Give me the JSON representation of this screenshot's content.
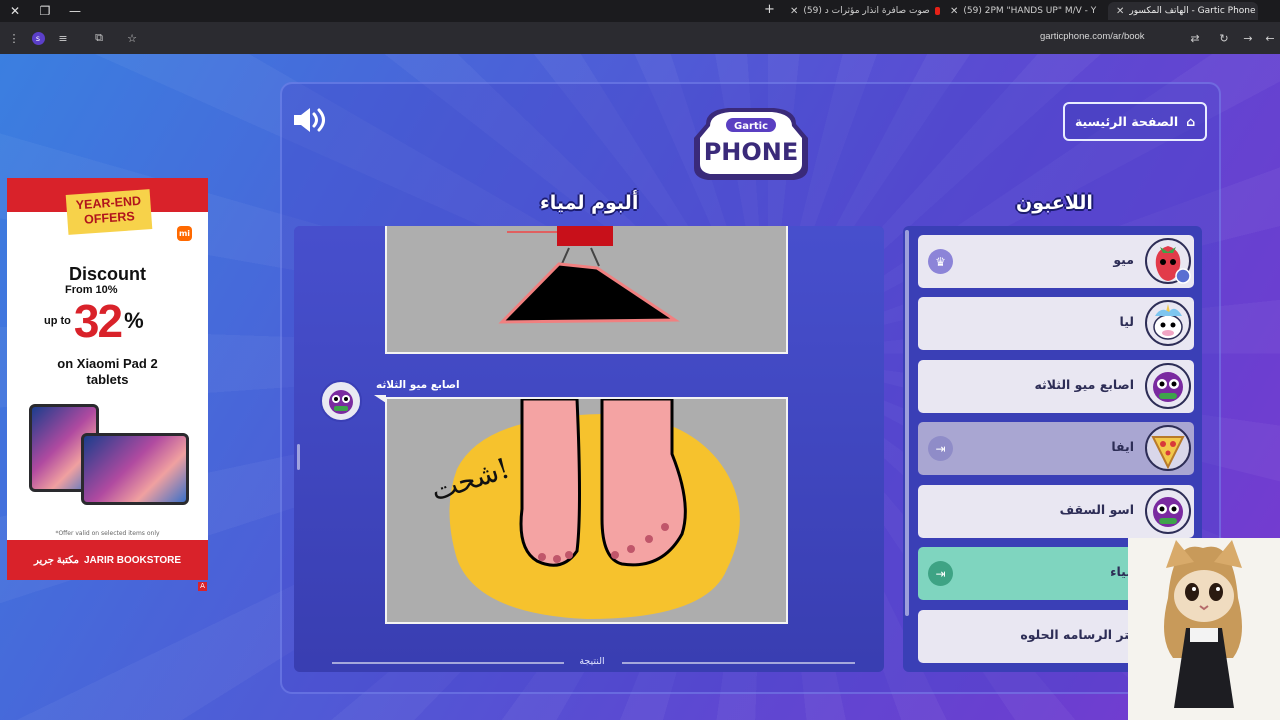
{
  "browser": {
    "tabs": [
      {
        "title": "الهاتف المكسور - Gartic Phone",
        "icon": "gartic-icon"
      },
      {
        "title": "(59) 2PM \"HANDS UP\" M/V - Y",
        "icon": "youtube-icon"
      },
      {
        "title": "(59) صوت صافرة انذار مؤثرات د",
        "icon": "youtube-icon"
      }
    ],
    "url": "garticphone.com/ar/book"
  },
  "ad": {
    "offer": "YEAR-END OFFERS",
    "brand_badge": "mi",
    "headline": "Discount",
    "from": "From 10%",
    "upto": "up to",
    "percent": "32",
    "percent_sign": "%",
    "product": "on Xiaoni Pad 2 tablets",
    "product_line1": "on Xiaomi Pad 2",
    "product_line2": "tablets",
    "fine_print": "*Offer valid on selected items only",
    "store": "JARIR BOOKSTORE",
    "store_ar": "مكتبة جرير",
    "ad_mark": "A"
  },
  "game": {
    "logo_top": "Gartic",
    "logo_bottom": "PHONE",
    "home_label": "الصفحة الرئيسية",
    "album_title": "ألبوم لمياء",
    "players_title": "اللاعبون",
    "drawing_author": "اصابع ميو الثلاثه",
    "drawing_caption": "شحت!",
    "footer_label": "النتيجة",
    "players": [
      {
        "name": "ميو",
        "badge": "crown-icon",
        "style": "white"
      },
      {
        "name": "ليا",
        "badge": "",
        "style": "white"
      },
      {
        "name": "اصابع ميو الثلاثه",
        "badge": "",
        "style": "white"
      },
      {
        "name": "ايفا",
        "badge": "exit-icon",
        "style": "gray"
      },
      {
        "name": "اسو السقف",
        "badge": "",
        "style": "white"
      },
      {
        "name": "مياء",
        "badge": "exit-icon",
        "style": "green"
      },
      {
        "name": "لتر الرسامه الحلوه",
        "badge": "",
        "style": "white"
      }
    ]
  },
  "colors": {
    "accent_purple": "#5a4bd2",
    "player_green": "#7fd5bf",
    "ad_red": "#d9222a"
  }
}
